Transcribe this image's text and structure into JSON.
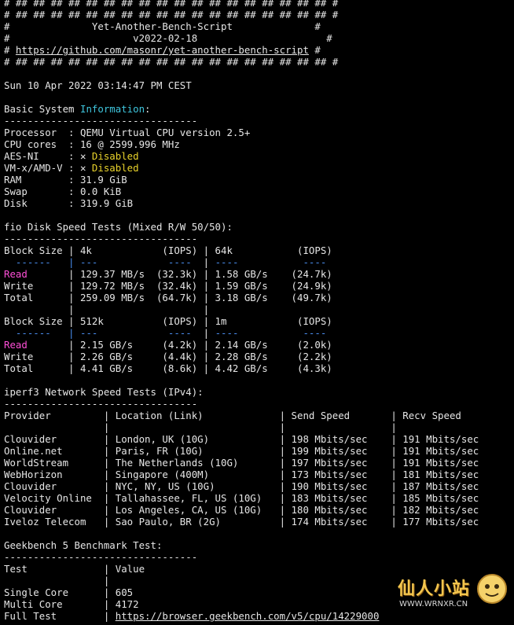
{
  "terminal": {
    "lines": [
      [
        {
          "t": "# ## ## ## ## ## ## ## ## ## ## ## ## ## ## ## ## ## ## #"
        }
      ],
      [
        {
          "t": "# ## ## ## ## ## ## ## ## ## ## ## ## ## ## ## ## ## ## #"
        }
      ],
      [
        {
          "t": "#              Yet-Another-Bench-Script              #"
        }
      ],
      [
        {
          "t": "#                     v2022-02-18                      #"
        }
      ],
      [
        {
          "t": "# "
        },
        {
          "t": "https://github.com/masonr/yet-another-bench-script",
          "c": "ul"
        },
        {
          "t": " #"
        }
      ],
      [
        {
          "t": "# ## ## ## ## ## ## ## ## ## ## ## ## ## ## ## ## ## ## #"
        }
      ],
      [
        {
          "t": ""
        }
      ],
      [
        {
          "t": "Sun 10 Apr 2022 03:14:47 PM CEST"
        }
      ],
      [
        {
          "t": ""
        }
      ],
      [
        {
          "t": "Basic System "
        },
        {
          "t": "Information",
          "c": "cyan"
        },
        {
          "t": ":"
        }
      ],
      [
        {
          "t": "---------------------------------"
        }
      ],
      [
        {
          "t": "Processor  : QEMU Virtual CPU version 2.5+"
        }
      ],
      [
        {
          "t": "CPU cores  : 16 @ 2599.996 MHz"
        }
      ],
      [
        {
          "t": "AES-NI     : ✕ "
        },
        {
          "t": "Disabled",
          "c": "yellow"
        }
      ],
      [
        {
          "t": "VM-x/AMD-V : ✕ "
        },
        {
          "t": "Disabled",
          "c": "yellow"
        }
      ],
      [
        {
          "t": "RAM        : 31.9 GiB"
        }
      ],
      [
        {
          "t": "Swap       : 0.0 KiB"
        }
      ],
      [
        {
          "t": "Disk       : 319.9 GiB"
        }
      ],
      [
        {
          "t": ""
        }
      ],
      [
        {
          "t": "fio Disk Speed Tests (Mixed R/W 50/50):"
        }
      ],
      [
        {
          "t": "---------------------------------"
        }
      ],
      [
        {
          "t": "Block Size | 4k            (IOPS) | 64k           (IOPS)"
        }
      ],
      [
        {
          "t": "  ------   | ",
          "c": "blue"
        },
        {
          "t": "---            ----  ",
          "c": "blue"
        },
        {
          "t": "| "
        },
        {
          "t": "----           ---- ",
          "c": "blue"
        }
      ],
      [
        {
          "t": "Read",
          "c": "magenta"
        },
        {
          "t": "       | 129.37 MB/s  (32.3k) | 1.58 GB/s    (24.7k)"
        }
      ],
      [
        {
          "t": "Write      | 129.72 MB/s  (32.4k) | 1.59 GB/s    (24.9k)"
        }
      ],
      [
        {
          "t": "Total      | 259.09 MB/s  (64.7k) | 3.18 GB/s    (49.7k)"
        }
      ],
      [
        {
          "t": "           |                      |"
        }
      ],
      [
        {
          "t": "Block Size | 512k          (IOPS) | 1m            (IOPS)"
        }
      ],
      [
        {
          "t": "  ------   | ",
          "c": "blue"
        },
        {
          "t": "---            ----  ",
          "c": "blue"
        },
        {
          "t": "| "
        },
        {
          "t": "----           ---- ",
          "c": "blue"
        }
      ],
      [
        {
          "t": "Read",
          "c": "magenta"
        },
        {
          "t": "       | 2.15 GB/s     (4.2k) | 2.14 GB/s     (2.0k)"
        }
      ],
      [
        {
          "t": "Write      | 2.26 GB/s     (4.4k) | 2.28 GB/s     (2.2k)"
        }
      ],
      [
        {
          "t": "Total      | 4.41 GB/s     (8.6k) | 4.42 GB/s     (4.3k)"
        }
      ],
      [
        {
          "t": ""
        }
      ],
      [
        {
          "t": "iperf3 Network Speed Tests (IPv4):"
        }
      ],
      [
        {
          "t": "---------------------------------"
        }
      ],
      [
        {
          "t": "Provider         | Location (Link)             | Send Speed       | Recv Speed"
        }
      ],
      [
        {
          "t": "                 |                             |                  |"
        }
      ],
      [
        {
          "t": "Clouvider        | London, UK (10G)            | 198 Mbits/sec    | 191 Mbits/sec"
        }
      ],
      [
        {
          "t": "Online.net       | Paris, FR (10G)             | 199 Mbits/sec    | 191 Mbits/sec"
        }
      ],
      [
        {
          "t": "WorldStream      | The Netherlands (10G)       | 197 Mbits/sec    | 191 Mbits/sec"
        }
      ],
      [
        {
          "t": "WebHorizon       | Singapore (400M)            | 173 Mbits/sec    | 181 Mbits/sec"
        }
      ],
      [
        {
          "t": "Clouvider        | NYC, NY, US (10G)           | 190 Mbits/sec    | 187 Mbits/sec"
        }
      ],
      [
        {
          "t": "Velocity Online  | Tallahassee, FL, US (10G)   | 183 Mbits/sec    | 185 Mbits/sec"
        }
      ],
      [
        {
          "t": "Clouvider        | Los Angeles, CA, US (10G)   | 180 Mbits/sec    | 182 Mbits/sec"
        }
      ],
      [
        {
          "t": "Iveloz Telecom   | Sao Paulo, BR (2G)          | 174 Mbits/sec    | 177 Mbits/sec"
        }
      ],
      [
        {
          "t": ""
        }
      ],
      [
        {
          "t": "Geekbench 5 Benchmark Test:"
        }
      ],
      [
        {
          "t": "---------------------------------"
        }
      ],
      [
        {
          "t": "Test             | Value"
        }
      ],
      [
        {
          "t": "                 |"
        }
      ],
      [
        {
          "t": "Single Core      | 605"
        }
      ],
      [
        {
          "t": "Multi Core       | 4172"
        }
      ],
      [
        {
          "t": "Full Test        | "
        },
        {
          "t": "https://browser.geekbench.com/v5/cpu/14229000",
          "c": "ul"
        }
      ]
    ]
  },
  "watermark": {
    "title": "仙人小站",
    "url": "WWW.WRNXR.CN"
  },
  "colors": {
    "background": "#000000",
    "text": "#e6e6e6",
    "cyan": "#3fc6de",
    "yellow": "#e8d22b",
    "magenta": "#ff4fd8",
    "blue": "#4a8ef0"
  }
}
